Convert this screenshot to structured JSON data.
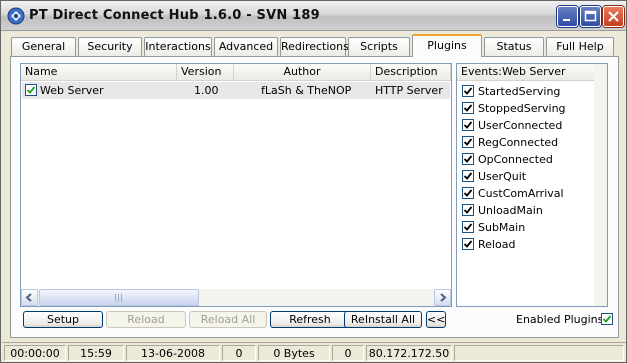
{
  "window": {
    "title": "PT Direct Connect Hub 1.6.0 - SVN 189"
  },
  "tabs": [
    {
      "label": "General"
    },
    {
      "label": "Security"
    },
    {
      "label": "Interactions"
    },
    {
      "label": "Advanced"
    },
    {
      "label": "Redirections"
    },
    {
      "label": "Scripts"
    },
    {
      "label": "Plugins",
      "active": true
    },
    {
      "label": "Status"
    },
    {
      "label": "Full Help"
    }
  ],
  "plugins_list": {
    "columns": [
      "Name",
      "Version",
      "Author",
      "Description"
    ],
    "rows": [
      {
        "checked": true,
        "name": "Web Server",
        "version": "1.00",
        "author": "fLaSh & TheNOP",
        "description": "HTTP Server"
      }
    ]
  },
  "events_panel": {
    "header": "Events:Web Server",
    "items": [
      {
        "label": "StartedServing",
        "checked": true
      },
      {
        "label": "StoppedServing",
        "checked": true
      },
      {
        "label": "UserConnected",
        "checked": true
      },
      {
        "label": "RegConnected",
        "checked": true
      },
      {
        "label": "OpConnected",
        "checked": true
      },
      {
        "label": "UserQuit",
        "checked": true
      },
      {
        "label": "CustComArrival",
        "checked": true
      },
      {
        "label": "UnloadMain",
        "checked": true
      },
      {
        "label": "SubMain",
        "checked": true
      },
      {
        "label": "Reload",
        "checked": true
      }
    ]
  },
  "buttons": {
    "setup": "Setup",
    "reload": "Reload",
    "reload_all": "Reload All",
    "refresh": "Refresh",
    "reinstall_all": "ReInstall All",
    "collapse": "<<"
  },
  "enabled_plugins": {
    "label": "Enabled Plugins",
    "checked": true
  },
  "status_bar": {
    "uptime": "00:00:00",
    "time": "15:59",
    "date": "13-06-2008",
    "users": "0",
    "shared": "0 Bytes",
    "ops": "0",
    "ip": "80.172.172.50"
  },
  "colors": {
    "active_tab_accent": "#f0a433",
    "close_button": "#c4401f",
    "caption_buttons": "#2f4ea8"
  }
}
